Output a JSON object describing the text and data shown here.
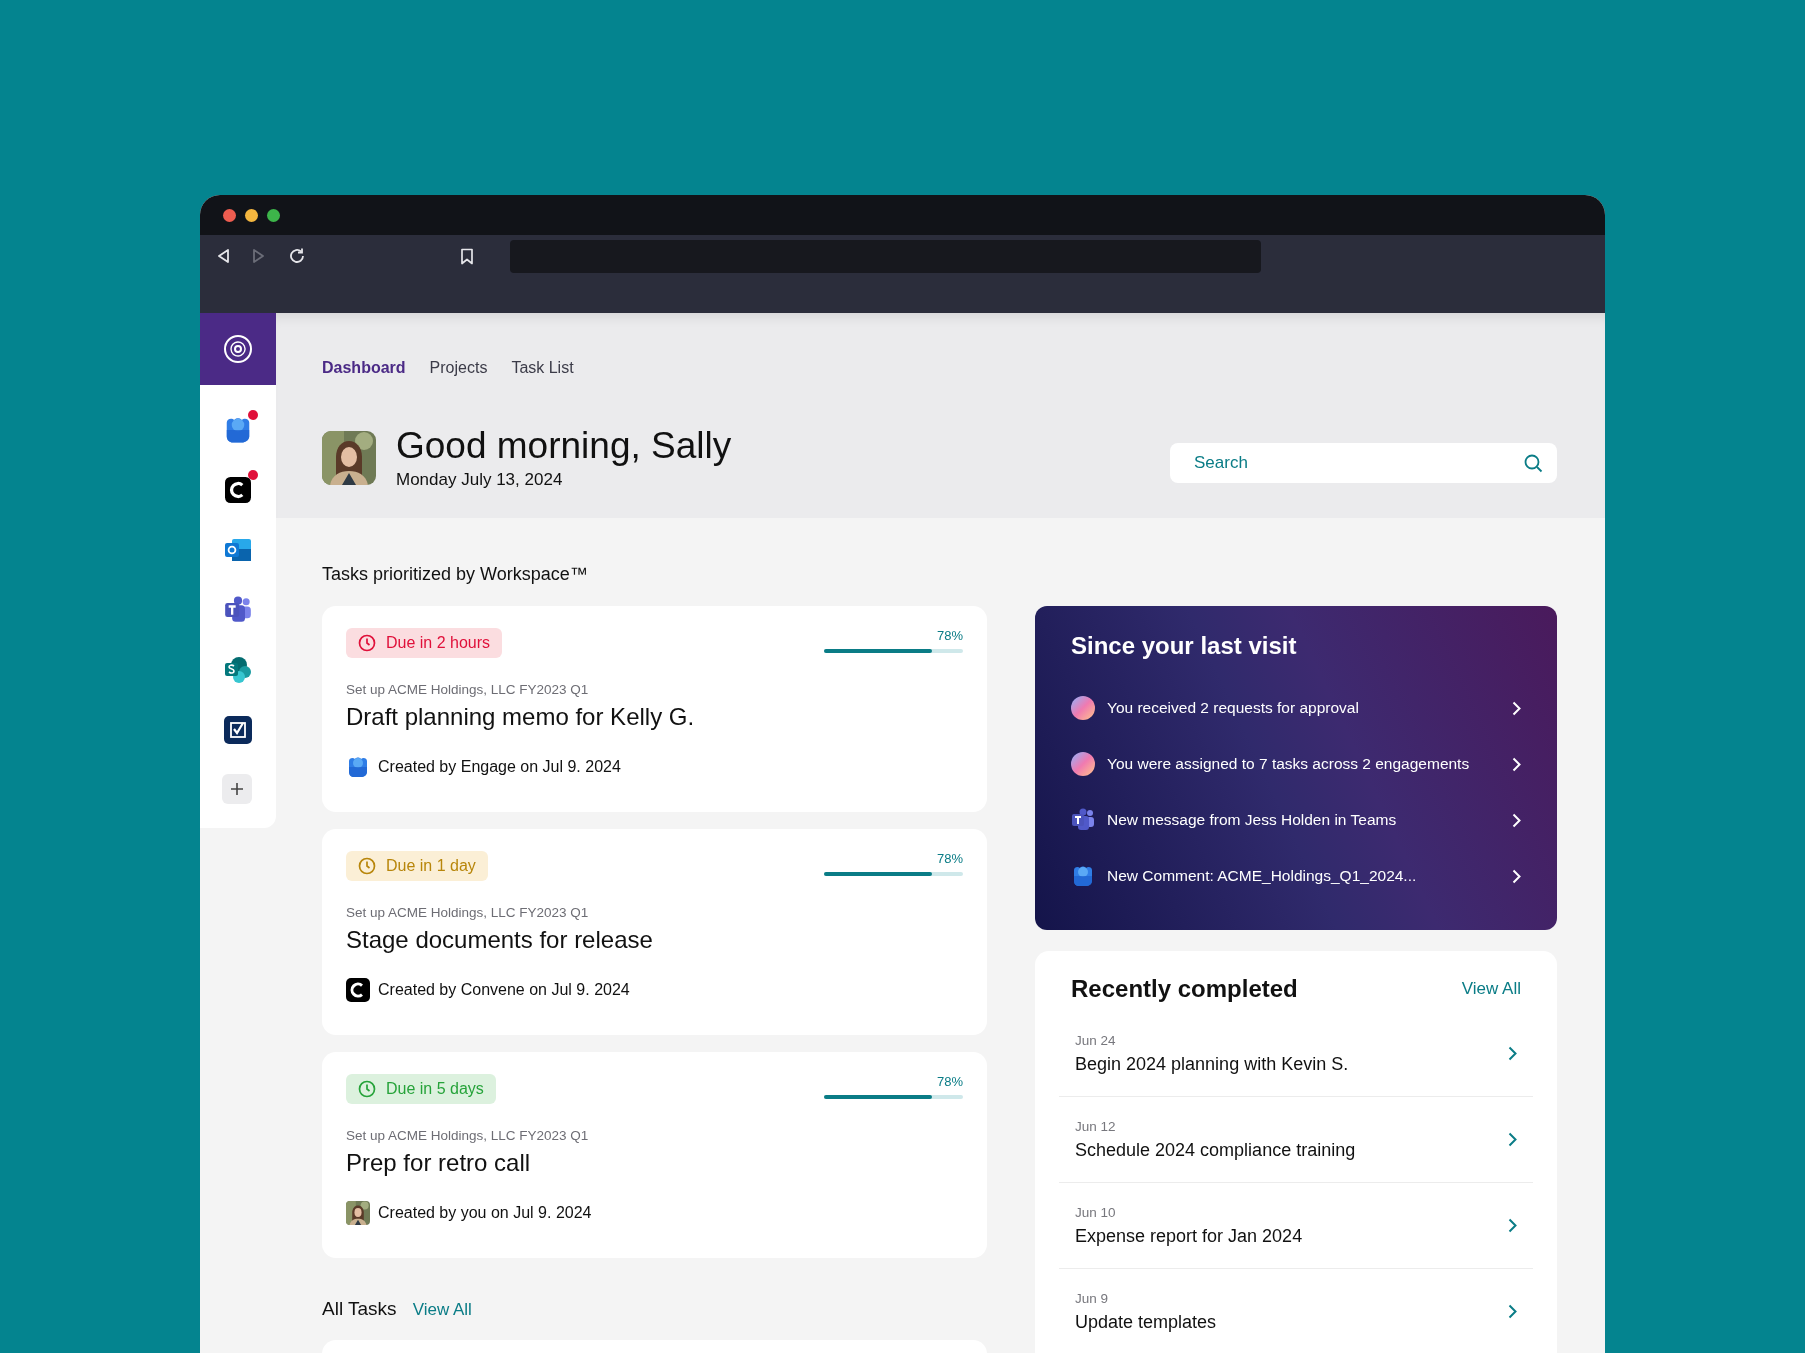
{
  "browser": {
    "back_enabled": true,
    "forward_enabled": false
  },
  "sidebar": {
    "apps": [
      {
        "kind": "engage",
        "notified": true
      },
      {
        "kind": "convene",
        "notified": true
      },
      {
        "kind": "outlook",
        "notified": false
      },
      {
        "kind": "teams",
        "notified": false
      },
      {
        "kind": "sharepoint",
        "notified": false
      },
      {
        "kind": "checklist",
        "notified": false
      },
      {
        "kind": "add",
        "notified": false
      }
    ]
  },
  "nav": {
    "tabs": [
      {
        "label": "Dashboard",
        "selected": true
      },
      {
        "label": "Projects",
        "selected": false
      },
      {
        "label": "Task List",
        "selected": false
      }
    ]
  },
  "greeting": {
    "title": "Good morning, Sally",
    "date": "Monday July 13, 2024"
  },
  "search": {
    "placeholder": "Search"
  },
  "tasks": {
    "heading": "Tasks prioritized by Workspace™",
    "items": [
      {
        "due": "Due in 2 hours",
        "kind": "urgent",
        "reading": "78%",
        "level": 0.78,
        "project": "Set up ACME Holdings, LLC FY2023 Q1",
        "title": "Draft planning memo for Kelly G.",
        "creator_icon": {
          "kind": "engage"
        },
        "created": "Created by Engage on Jul 9. 2024"
      },
      {
        "due": "Due in 1 day",
        "kind": "soon",
        "reading": "78%",
        "level": 0.78,
        "project": "Set up ACME Holdings, LLC FY2023 Q1",
        "title": "Stage documents for release",
        "creator_icon": {
          "kind": "convene"
        },
        "created": "Created by Convene on Jul 9. 2024"
      },
      {
        "due": "Due in 5 days",
        "kind": "later",
        "reading": "78%",
        "level": 0.78,
        "project": "Set up ACME Holdings, LLC FY2023 Q1",
        "title": "Prep for retro call",
        "creator_icon": {
          "kind": "avatar"
        },
        "created": "Created by you on Jul 9. 2024"
      }
    ]
  },
  "all_tasks": {
    "heading": "All Tasks",
    "link": "View All"
  },
  "since_last_visit": {
    "title": "Since your last visit",
    "items": [
      {
        "kind": "gradient",
        "text": "You received 2 requests for approval"
      },
      {
        "kind": "gradient",
        "text": "You were assigned to 7 tasks across 2 engagements"
      },
      {
        "kind": "teams",
        "text": "New message from Jess Holden in Teams"
      },
      {
        "kind": "engage",
        "text": "New Comment: ACME_Holdings_Q1_2024..."
      }
    ]
  },
  "recently_completed": {
    "title": "Recently completed",
    "link": "View All",
    "items": [
      {
        "date": "Jun 24",
        "title": "Begin 2024 planning with Kevin S."
      },
      {
        "date": "Jun 12",
        "title": "Schedule 2024 compliance training"
      },
      {
        "date": "Jun 10",
        "title": "Expense report for Jan 2024"
      },
      {
        "date": "Jun 9",
        "title": "Update templates"
      }
    ]
  }
}
